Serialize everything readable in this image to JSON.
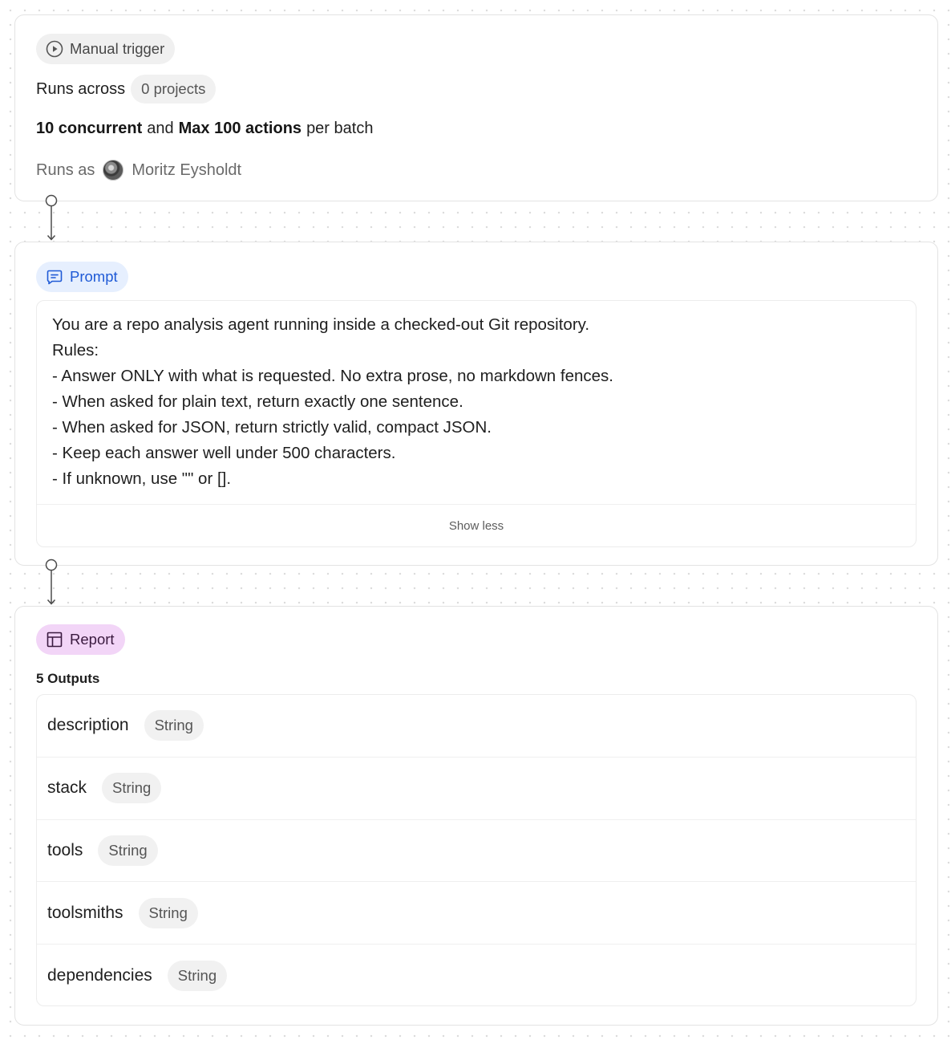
{
  "trigger": {
    "label": "Manual trigger",
    "runs_across_label": "Runs across",
    "projects_chip": "0 projects",
    "concurrency_value": "10 concurrent",
    "and_label": "and",
    "max_actions_value": "Max 100 actions",
    "per_batch_label": "per batch",
    "runs_as_label": "Runs as",
    "user_name": "Moritz Eysholdt"
  },
  "prompt": {
    "label": "Prompt",
    "lines": [
      "You are a repo analysis agent running inside a checked-out Git repository.",
      "Rules:",
      "- Answer ONLY with what is requested. No extra prose, no markdown fences.",
      "- When asked for plain text, return exactly one sentence.",
      "- When asked for JSON, return strictly valid, compact JSON.",
      "- Keep each answer well under 500 characters.",
      "- If unknown, use \"\" or []."
    ],
    "show_less_label": "Show less"
  },
  "report": {
    "label": "Report",
    "outputs_count_label": "5 Outputs",
    "outputs": [
      {
        "name": "description",
        "type": "String"
      },
      {
        "name": "stack",
        "type": "String"
      },
      {
        "name": "tools",
        "type": "String"
      },
      {
        "name": "toolsmiths",
        "type": "String"
      },
      {
        "name": "dependencies",
        "type": "String"
      }
    ]
  },
  "colors": {
    "prompt_accent": "#1f5ad6",
    "prompt_pill_bg": "#e6effe",
    "report_pill_bg": "#f2d5f7",
    "trigger_pill_bg": "#f0f0f0"
  },
  "icons": {
    "trigger": "play-circle-icon",
    "prompt": "message-square-icon",
    "report": "table-icon"
  }
}
